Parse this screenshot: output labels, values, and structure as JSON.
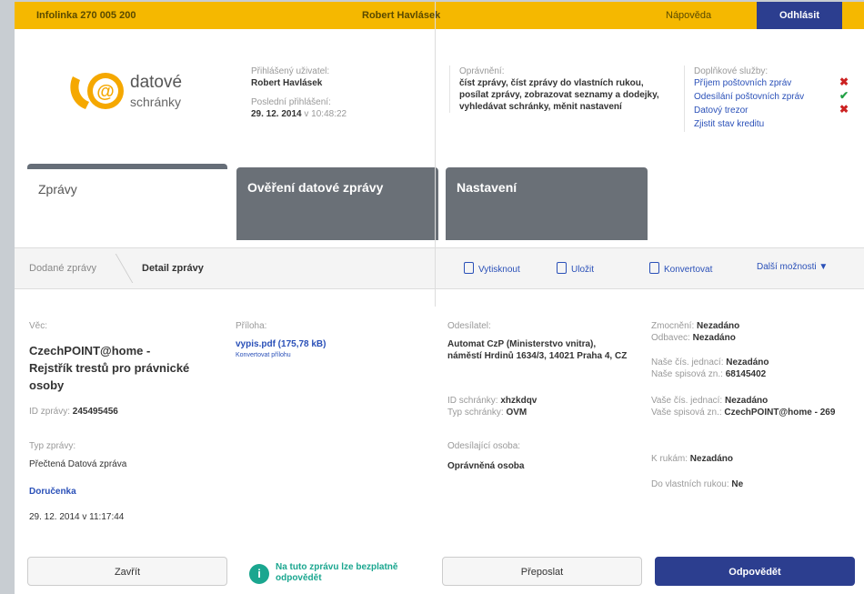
{
  "topbar": {
    "phone": "Infolinka 270 005 200",
    "user": "Robert Havlásek",
    "help": "Nápověda",
    "logout": "Odhlásit"
  },
  "logo": {
    "line1": "datové",
    "line2": "schránky"
  },
  "account": {
    "user_label": "Přihlášený uživatel:",
    "user_name": "Robert Havlásek",
    "last_login_label": "Poslední přihlášení:",
    "last_login_date": "29. 12. 2014",
    "last_login_time": "v 10:48:22"
  },
  "permissions": {
    "label": "Oprávnění:",
    "text": "číst zprávy, číst zprávy do vlastních rukou, posílat zprávy, zobrazovat seznamy a dodejky, vyhledávat schránky, měnit nastavení"
  },
  "services": {
    "label": "Doplňkové služby:",
    "items": [
      {
        "label": "Příjem poštovních zpráv",
        "mark": "✖"
      },
      {
        "label": "Odesílání poštovních zpráv",
        "mark": "✔"
      },
      {
        "label": "Datový trezor",
        "mark": "✖"
      },
      {
        "label": "Zjistit stav kreditu",
        "mark": ""
      }
    ]
  },
  "tabs": {
    "zpravy": "Zprávy",
    "overeni": "Ověření datové zprávy",
    "nastaveni": "Nastavení"
  },
  "toolbar": {
    "crumb1": "Dodané zprávy",
    "crumb2": "Detail zprávy",
    "print": "Vytisknout",
    "save": "Uložit",
    "convert": "Konvertovat",
    "more": "Další možnosti ▼"
  },
  "message": {
    "subject_label": "Věc:",
    "subject": "CzechPOINT@home - Rejstřík trestů pro právnické osoby",
    "id_label": "ID zprávy:",
    "id": "245495456",
    "type_label": "Typ zprávy:",
    "type": "Přečtená Datová zpráva",
    "delivery_link": "Doručenka",
    "delivery_date": "29. 12. 2014 v 11:17:44",
    "attachment_label": "Příloha:",
    "attachment_file": "vypis.pdf (175,78 kB)",
    "attachment_convert": "Konvertovat přílohu"
  },
  "sender": {
    "label": "Odesílatel:",
    "name": "Automat CzP (Ministerstvo vnitra), náměstí Hrdinů 1634/3, 14021 Praha 4, CZ",
    "box_id_label": "ID schránky:",
    "box_id": "xhzkdqv",
    "box_type_label": "Typ schránky:",
    "box_type": "OVM",
    "person_label": "Odesílající osoba:",
    "person": "Oprávněná osoba"
  },
  "details": {
    "authorized_label": "Zmocnění:",
    "authorized": "Nezadáno",
    "recipient_label": "Odbavec:",
    "recipient": "Nezadáno",
    "our_ref_label": "Naše čís. jednací:",
    "our_ref": "Nezadáno",
    "our_file_label": "Naše spisová zn.:",
    "our_file": "68145402",
    "your_ref_label": "Vaše čís. jednací:",
    "your_ref": "Nezadáno",
    "your_file_label": "Vaše spisová zn.:",
    "your_file": "CzechPOINT@home - 269",
    "attn_label": "K rukám:",
    "attn": "Nezadáno",
    "own_hands_label": "Do vlastních rukou:",
    "own_hands": "Ne"
  },
  "footer": {
    "close": "Zavřít",
    "info": "Na tuto zprávu lze bezplatně odpovědět",
    "forward": "Přeposlat",
    "reply": "Odpovědět"
  },
  "colors": {
    "accent_yellow": "#f5b800",
    "primary_blue": "#2c3e8f",
    "link_blue": "#2a50b8",
    "teal": "#1aa68f"
  }
}
